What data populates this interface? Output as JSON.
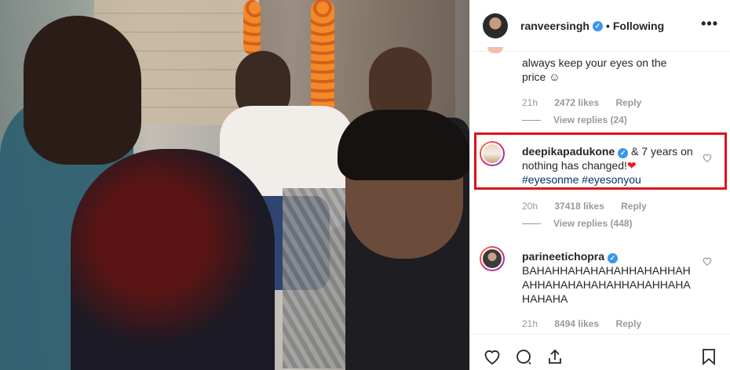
{
  "header": {
    "username": "ranveersingh",
    "separator": "•",
    "following_label": "Following",
    "more_label": "•••"
  },
  "comments": [
    {
      "text": "always keep your eyes on the price ☺",
      "time": "21h",
      "likes": "2472 likes",
      "reply_label": "Reply",
      "view_replies": "View replies (24)"
    },
    {
      "username": "deepikapadukone",
      "text_part1": " & 7 years on nothing has changed!",
      "heart": "❤",
      "hashtag1": "#eyesonme",
      "hashtag2": "#eyesonyou",
      "time": "20h",
      "likes": "37418 likes",
      "reply_label": "Reply",
      "view_replies": "View replies (448)"
    },
    {
      "username": "parineetichopra",
      "text": "BAHAHHAHAHAHAHHAHAHHAHAHHAHAHAHAHAHHAHAHHAHAHAHAHA",
      "time": "21h",
      "likes": "8494 likes",
      "reply_label": "Reply"
    }
  ],
  "colors": {
    "highlight_border": "#e0101a",
    "verified_blue": "#3897f0",
    "hashtag": "#003569",
    "meta_gray": "#999999"
  },
  "icons": [
    "verified-icon",
    "more-icon",
    "heart-outline-icon",
    "comment-icon",
    "share-icon",
    "bookmark-icon"
  ]
}
